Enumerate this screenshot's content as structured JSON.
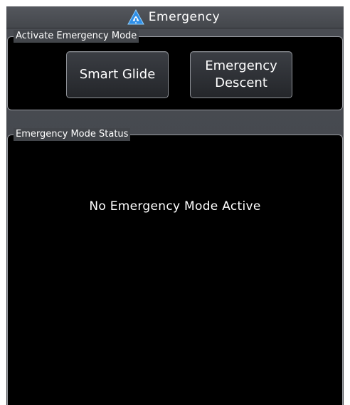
{
  "header": {
    "title": "Emergency",
    "icon": "emergency-warning-icon"
  },
  "activate_group": {
    "label": "Activate Emergency Mode",
    "buttons": [
      {
        "label_line1": "Smart Glide"
      },
      {
        "label_line1": "Emergency",
        "label_line2": "Descent"
      }
    ]
  },
  "status_group": {
    "label": "Emergency Mode Status",
    "message": "No Emergency Mode Active"
  },
  "colors": {
    "background": "#000000",
    "chrome": "#474a4f",
    "warning_icon": "#2f8fe8",
    "text": "#ffffff"
  }
}
